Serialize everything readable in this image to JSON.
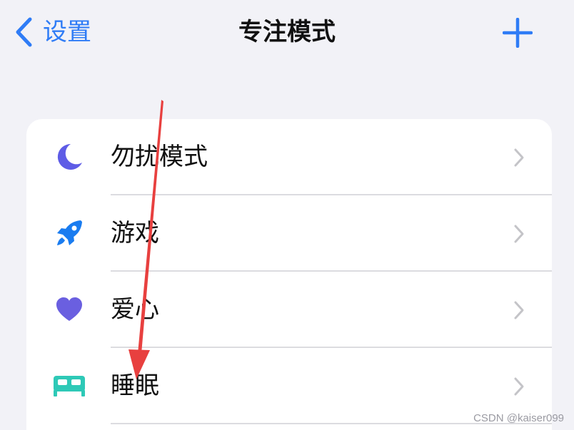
{
  "nav": {
    "back_label": "设置",
    "title": "专注模式",
    "accent": "#2f7cf6"
  },
  "modes": [
    {
      "label": "勿扰模式",
      "icon": "moon-icon",
      "color": "#5e5ce6"
    },
    {
      "label": "游戏",
      "icon": "rocket-icon",
      "color": "#1a7cf0"
    },
    {
      "label": "爱心",
      "icon": "heart-icon",
      "color": "#6a5fe0"
    },
    {
      "label": "睡眠",
      "icon": "bed-icon",
      "color": "#2ec9b7"
    }
  ],
  "watermark": "CSDN @kaiser099",
  "annotation_color": "#e8403f"
}
